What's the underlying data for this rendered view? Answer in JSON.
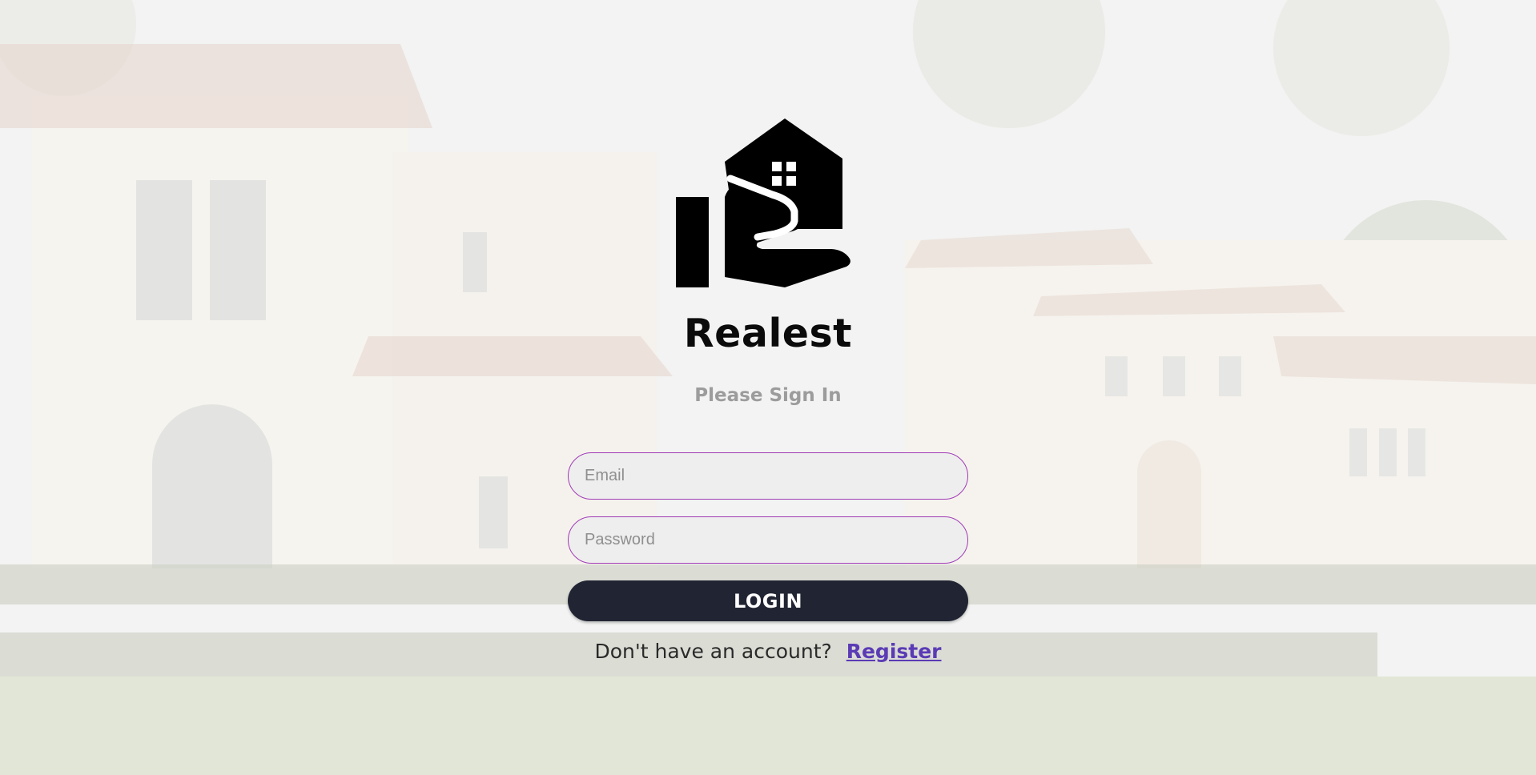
{
  "brand": {
    "name": "Realest",
    "logo_icon": "house-in-hand-icon"
  },
  "form": {
    "subtitle": "Please Sign In",
    "email_placeholder": "Email",
    "email_value": "",
    "password_placeholder": "Password",
    "password_value": "",
    "login_label": "LOGIN"
  },
  "footer": {
    "prompt": "Don't have an account?",
    "register_label": "Register"
  },
  "colors": {
    "input_border": "#a03bb6",
    "button_bg": "#212533",
    "link": "#5b3bb5",
    "subtitle": "#9c9c9c"
  }
}
